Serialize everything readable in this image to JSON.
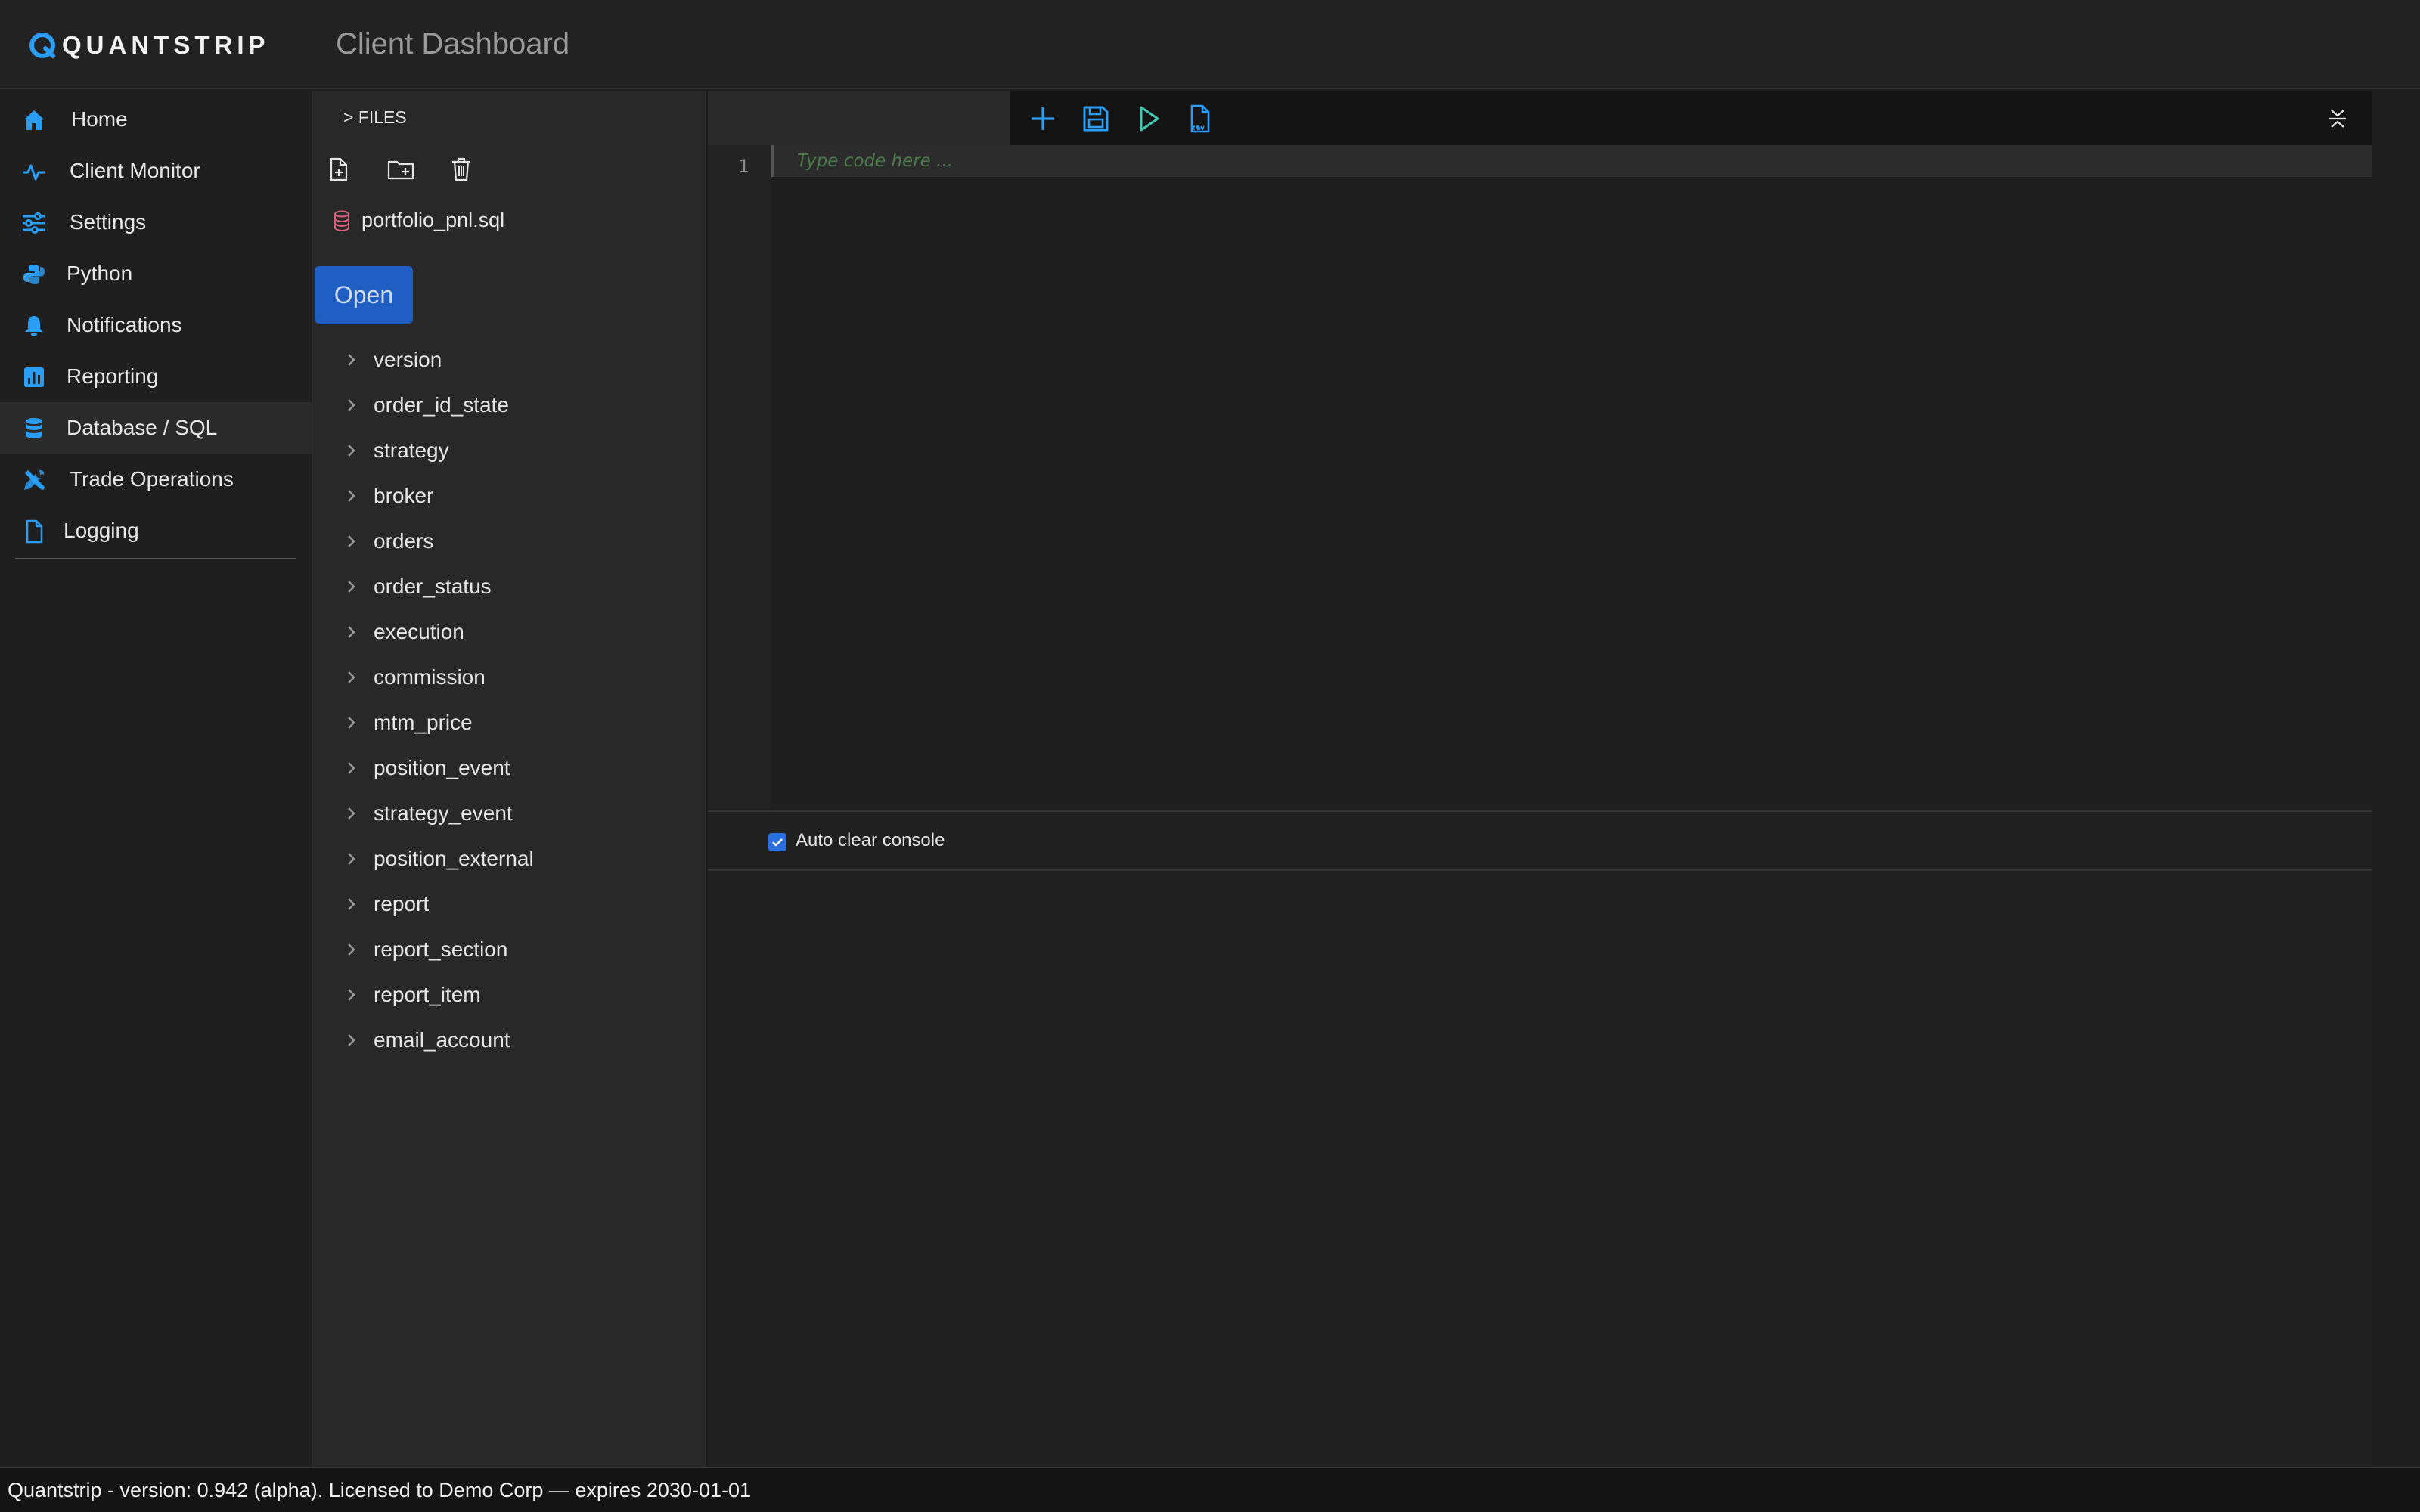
{
  "app": {
    "logo_text": "QUANTSTRIP",
    "page_title": "Client Dashboard",
    "accent": "#2a9df4"
  },
  "nav": {
    "items": [
      {
        "label": "Home",
        "icon": "home-icon"
      },
      {
        "label": "Client Monitor",
        "icon": "activity-icon"
      },
      {
        "label": "Settings",
        "icon": "sliders-icon"
      },
      {
        "label": "Python",
        "icon": "python-icon"
      },
      {
        "label": "Notifications",
        "icon": "bell-icon"
      },
      {
        "label": "Reporting",
        "icon": "chart-icon"
      },
      {
        "label": "Database / SQL",
        "icon": "database-icon",
        "active": true
      },
      {
        "label": "Trade Operations",
        "icon": "tools-icon"
      },
      {
        "label": "Logging",
        "icon": "file-icon"
      }
    ]
  },
  "files": {
    "title": "> FILES",
    "file_name": "portfolio_pnl.sql",
    "open_label": "Open",
    "tables": [
      "version",
      "order_id_state",
      "strategy",
      "broker",
      "orders",
      "order_status",
      "execution",
      "commission",
      "mtm_price",
      "position_event",
      "strategy_event",
      "position_external",
      "report",
      "report_section",
      "report_item",
      "email_account"
    ]
  },
  "editor": {
    "line_number": "1",
    "placeholder": "Type code here ...",
    "auto_clear_label": "Auto clear console",
    "auto_clear_checked": true
  },
  "footer": {
    "text": "Quantstrip - version: 0.942 (alpha). Licensed to Demo Corp — expires 2030-01-01"
  }
}
